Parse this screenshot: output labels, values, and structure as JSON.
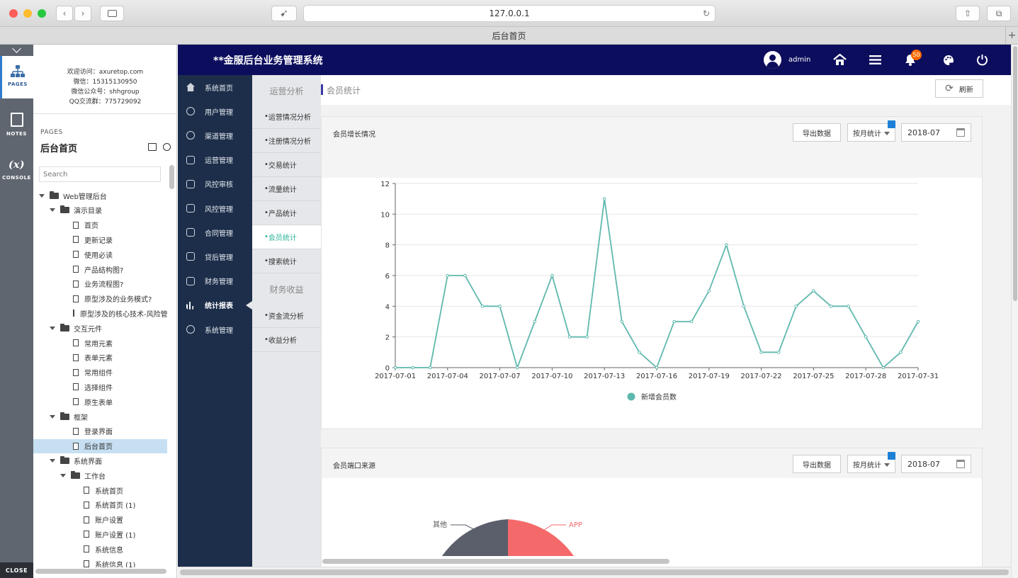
{
  "browser": {
    "url": "127.0.0.1",
    "tab_title": "后台首页"
  },
  "axure": {
    "rail": {
      "pages": "PAGES",
      "notes": "NOTES",
      "console": "CONSOLE",
      "console_glyph": "(x)",
      "close": "CLOSE"
    },
    "info": [
      "欢迎访问：axuretop.com",
      "微信：15315130950",
      "微信公众号：shhgroup",
      "QQ交流群：775729092"
    ],
    "pages_label": "PAGES",
    "page_title": "后台首页",
    "search_placeholder": "Search",
    "tree": [
      {
        "label": "Web管理后台",
        "type": "folder",
        "level": 0
      },
      {
        "label": "演示目录",
        "type": "folder",
        "level": 1
      },
      {
        "label": "首页",
        "type": "page",
        "level": 2
      },
      {
        "label": "更新记录",
        "type": "page",
        "level": 2
      },
      {
        "label": "使用必读",
        "type": "page",
        "level": 2
      },
      {
        "label": "产品结构图?",
        "type": "page",
        "level": 2
      },
      {
        "label": "业务流程图?",
        "type": "page",
        "level": 2
      },
      {
        "label": "原型涉及的业务模式?",
        "type": "page",
        "level": 2
      },
      {
        "label": "原型涉及的核心技术-风险管",
        "type": "page",
        "level": 2
      },
      {
        "label": "交互元件",
        "type": "folder",
        "level": 1
      },
      {
        "label": "常用元素",
        "type": "page",
        "level": 2
      },
      {
        "label": "表单元素",
        "type": "page",
        "level": 2
      },
      {
        "label": "常用组件",
        "type": "page",
        "level": 2
      },
      {
        "label": "选择组件",
        "type": "page",
        "level": 2
      },
      {
        "label": "原生表单",
        "type": "page",
        "level": 2
      },
      {
        "label": "框架",
        "type": "folder",
        "level": 1
      },
      {
        "label": "登录界面",
        "type": "page",
        "level": 2
      },
      {
        "label": "后台首页",
        "type": "page",
        "level": 2,
        "selected": true
      },
      {
        "label": "系统界面",
        "type": "folder",
        "level": 1
      },
      {
        "label": "工作台",
        "type": "folder",
        "level": 2
      },
      {
        "label": "系统首页",
        "type": "page",
        "level": 3
      },
      {
        "label": "系统首页 (1)",
        "type": "page",
        "level": 3
      },
      {
        "label": "账户设置",
        "type": "page",
        "level": 3
      },
      {
        "label": "账户设置 (1)",
        "type": "page",
        "level": 3
      },
      {
        "label": "系统信息",
        "type": "page",
        "level": 3
      },
      {
        "label": "系统信息 (1)",
        "type": "page",
        "level": 3
      }
    ]
  },
  "app": {
    "title": "**金服后台业务管理系统",
    "user": "admin",
    "notification_count": "50",
    "nav": [
      {
        "label": "系统首页",
        "icon": "home-icon"
      },
      {
        "label": "用户管理",
        "icon": "user-icon"
      },
      {
        "label": "渠道管理",
        "icon": "user-icon"
      },
      {
        "label": "运营管理",
        "icon": "box-icon"
      },
      {
        "label": "风控审核",
        "icon": "box-icon"
      },
      {
        "label": "风控管理",
        "icon": "check-icon"
      },
      {
        "label": "合同管理",
        "icon": "tag-icon"
      },
      {
        "label": "贷后管理",
        "icon": "wallet-icon"
      },
      {
        "label": "财务管理",
        "icon": "money-icon"
      },
      {
        "label": "统计报表",
        "icon": "bar-chart-icon",
        "active": true
      },
      {
        "label": "系统管理",
        "icon": "gear-icon"
      }
    ],
    "subnav": {
      "group1": "运营分析",
      "group1_items": [
        "运营情况分析",
        "注册情况分析",
        "交易统计",
        "流量统计",
        "产品统计",
        "会员统计",
        "搜索统计"
      ],
      "active_index": 5,
      "group2": "财务收益",
      "group2_items": [
        "资金流分析",
        "收益分析"
      ]
    },
    "breadcrumb": "会员统计",
    "refresh": "刷新",
    "panel1": {
      "title": "会员增长情况",
      "export": "导出数据",
      "period": "按月统计",
      "date": "2018-07"
    },
    "panel2": {
      "title": "会员端口来源",
      "export": "导出数据",
      "period": "按月统计",
      "date": "2018-07",
      "pie_labels": [
        "其他",
        "APP"
      ]
    },
    "colors": {
      "header": "#0d0d5e",
      "nav": "#1c2e4a",
      "line": "#5fb8ad",
      "accent": "#2db39a",
      "pie_app": "#f46a6a",
      "pie_other": "#5a5f6b",
      "badge": "#ff6a00"
    }
  },
  "chart_data": {
    "type": "line",
    "x": [
      "2017-07-01",
      "2017-07-02",
      "2017-07-03",
      "2017-07-04",
      "2017-07-05",
      "2017-07-06",
      "2017-07-07",
      "2017-07-08",
      "2017-07-09",
      "2017-07-10",
      "2017-07-11",
      "2017-07-12",
      "2017-07-13",
      "2017-07-14",
      "2017-07-15",
      "2017-07-16",
      "2017-07-17",
      "2017-07-18",
      "2017-07-19",
      "2017-07-20",
      "2017-07-21",
      "2017-07-22",
      "2017-07-23",
      "2017-07-24",
      "2017-07-25",
      "2017-07-26",
      "2017-07-27",
      "2017-07-28",
      "2017-07-29",
      "2017-07-30",
      "2017-07-31"
    ],
    "xticks": [
      "2017-07-01",
      "2017-07-04",
      "2017-07-07",
      "2017-07-10",
      "2017-07-13",
      "2017-07-16",
      "2017-07-19",
      "2017-07-22",
      "2017-07-25",
      "2017-07-28",
      "2017-07-31"
    ],
    "series": [
      {
        "name": "新增会员数",
        "values": [
          0,
          0,
          0,
          6,
          6,
          4,
          4,
          0,
          3,
          6,
          2,
          2,
          11,
          3,
          1,
          0,
          3,
          3,
          5,
          8,
          4,
          1,
          1,
          4,
          5,
          4,
          4,
          2,
          0,
          1,
          3
        ]
      }
    ],
    "ylim": [
      0,
      12
    ],
    "yticks": [
      "0",
      "2",
      "4",
      "6",
      "8",
      "10",
      "12"
    ],
    "grid": true,
    "legend": "bottom"
  }
}
